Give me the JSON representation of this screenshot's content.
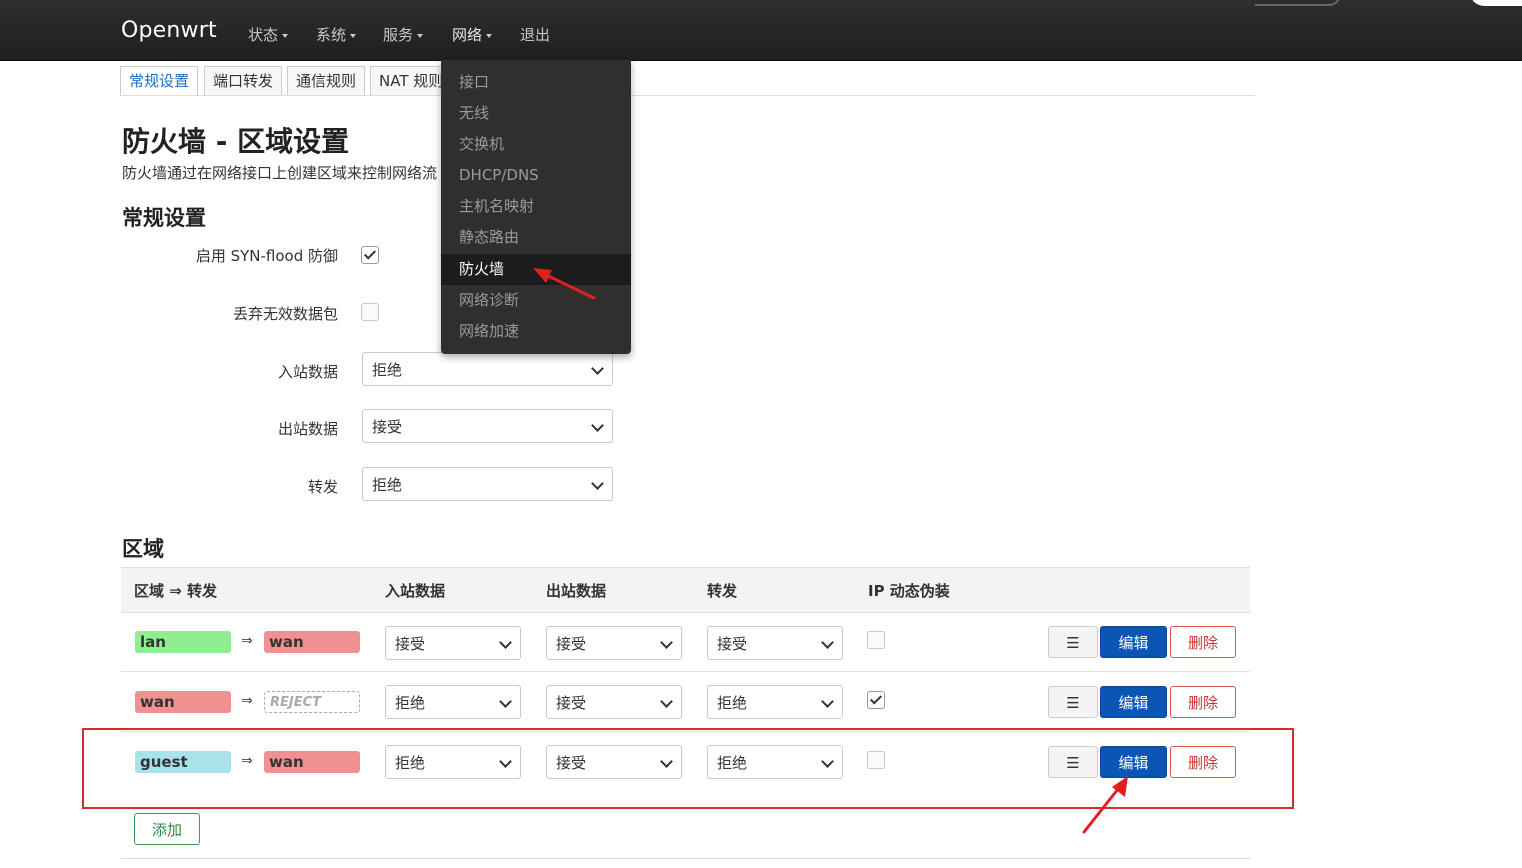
{
  "nav": {
    "brand": "Openwrt",
    "items": [
      {
        "label": "状态"
      },
      {
        "label": "系统"
      },
      {
        "label": "服务"
      },
      {
        "label": "网络"
      },
      {
        "label": "退出"
      }
    ]
  },
  "tabs": [
    "常规设置",
    "端口转发",
    "通信规则",
    "NAT 规则"
  ],
  "page": {
    "title": "防火墙 - 区域设置",
    "description": "防火墙通过在网络接口上创建区域来控制网络流"
  },
  "general": {
    "heading": "常规设置",
    "syn_flood_label": "启用 SYN-flood 防御",
    "syn_flood_checked": true,
    "drop_invalid_label": "丢弃无效数据包",
    "drop_invalid_checked": false,
    "input_label": "入站数据",
    "input_value": "拒绝",
    "output_label": "出站数据",
    "output_value": "接受",
    "forward_label": "转发",
    "forward_value": "拒绝"
  },
  "zones": {
    "heading": "区域",
    "columns": [
      "区域 ⇒ 转发",
      "入站数据",
      "出站数据",
      "转发",
      "IP 动态伪装"
    ],
    "rows": [
      {
        "name": "lan",
        "name_color": "#90ee90",
        "forward": "wan",
        "forward_color": "#f09090",
        "input": "接受",
        "output": "接受",
        "forward_policy": "接受",
        "masq": false
      },
      {
        "name": "wan",
        "name_color": "#f09090",
        "forward": "REJECT",
        "forward_color": "#ffffff",
        "input": "拒绝",
        "output": "接受",
        "forward_policy": "拒绝",
        "masq": true
      },
      {
        "name": "guest",
        "name_color": "#a8e2ea",
        "forward": "wan",
        "forward_color": "#f09090",
        "input": "拒绝",
        "output": "接受",
        "forward_policy": "拒绝",
        "masq": false
      }
    ],
    "menu_glyph": "☰",
    "edit_label": "编辑",
    "delete_label": "删除",
    "add_label": "添加"
  },
  "network_menu": {
    "items": [
      "接口",
      "无线",
      "交换机",
      "DHCP/DNS",
      "主机名映射",
      "静态路由",
      "防火墙",
      "网络诊断",
      "网络加速"
    ],
    "active": "防火墙"
  },
  "colors": {
    "accent": "#0b55b4",
    "annotation": "#d62b2b"
  }
}
